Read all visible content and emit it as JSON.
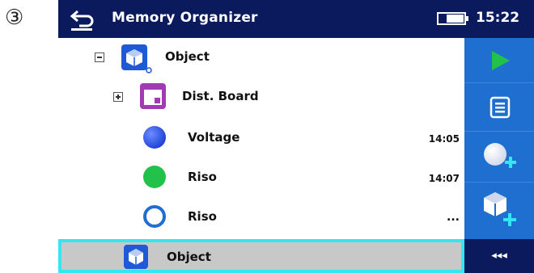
{
  "step_marker": "③",
  "titlebar": {
    "title": "Memory Organizer",
    "clock": "15:22"
  },
  "tree": {
    "rows": [
      {
        "label": "Object",
        "toggle": "collapse"
      },
      {
        "label": "Dist. Board",
        "toggle": "expand"
      },
      {
        "label": "Voltage",
        "time": "14:05",
        "status_color": "#2a54e6"
      },
      {
        "label": "Riso",
        "time": "14:07",
        "status_color": "#22c24a"
      },
      {
        "label": "Riso",
        "time": "...",
        "status_color": "#1e6fcf"
      }
    ],
    "selected": {
      "label": "Object"
    }
  },
  "sidebar": {
    "buttons": [
      "play-icon",
      "list-icon",
      "add-measurement-icon",
      "add-object-icon"
    ],
    "bottom_label": "◂◂◂"
  },
  "colors": {
    "titlebar": "#0b1a5c",
    "sidebar": "#1e6fcf",
    "selection_border": "#35e6f0",
    "selection_bg": "#c8c8c8"
  }
}
